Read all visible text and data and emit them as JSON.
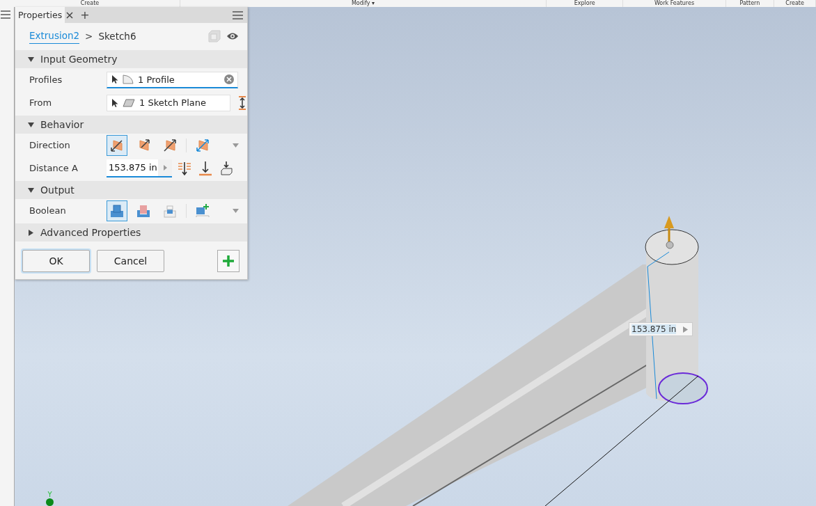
{
  "ribbon": {
    "groups": [
      "Create",
      "Modify ▾",
      "Explore",
      "Work Features",
      "Pattern",
      "Create"
    ]
  },
  "panel": {
    "tab": "Properties",
    "add_tab": "+",
    "breadcrumb": {
      "feature": "Extrusion2",
      "separator": ">",
      "sketch": "Sketch6"
    },
    "sections": [
      {
        "title": "Input Geometry",
        "expanded": true,
        "rows": [
          {
            "kind": "selector",
            "label": "Profiles",
            "value": "1 Profile",
            "active": true
          },
          {
            "kind": "selector",
            "label": "From",
            "value": "1 Sketch Plane",
            "active": false
          }
        ]
      },
      {
        "title": "Behavior",
        "expanded": true,
        "rows": [
          {
            "kind": "direction",
            "label": "Direction",
            "options": [
              {
                "selected": true
              },
              {
                "selected": false
              },
              {
                "selected": false
              },
              {
                "selected": false
              }
            ]
          },
          {
            "kind": "distance",
            "label": "Distance A",
            "value": "153.875 in"
          }
        ]
      },
      {
        "title": "Output",
        "expanded": true,
        "rows": [
          {
            "kind": "boolean",
            "label": "Boolean",
            "options": [
              {
                "selected": true
              },
              {
                "selected": false
              },
              {
                "selected": false
              },
              {
                "selected": false
              }
            ]
          }
        ]
      },
      {
        "title": "Advanced Properties",
        "expanded": false
      }
    ],
    "buttons": {
      "ok": "OK",
      "cancel": "Cancel"
    }
  },
  "viewport": {
    "dimension": "153.875 in",
    "axis": "Y"
  }
}
